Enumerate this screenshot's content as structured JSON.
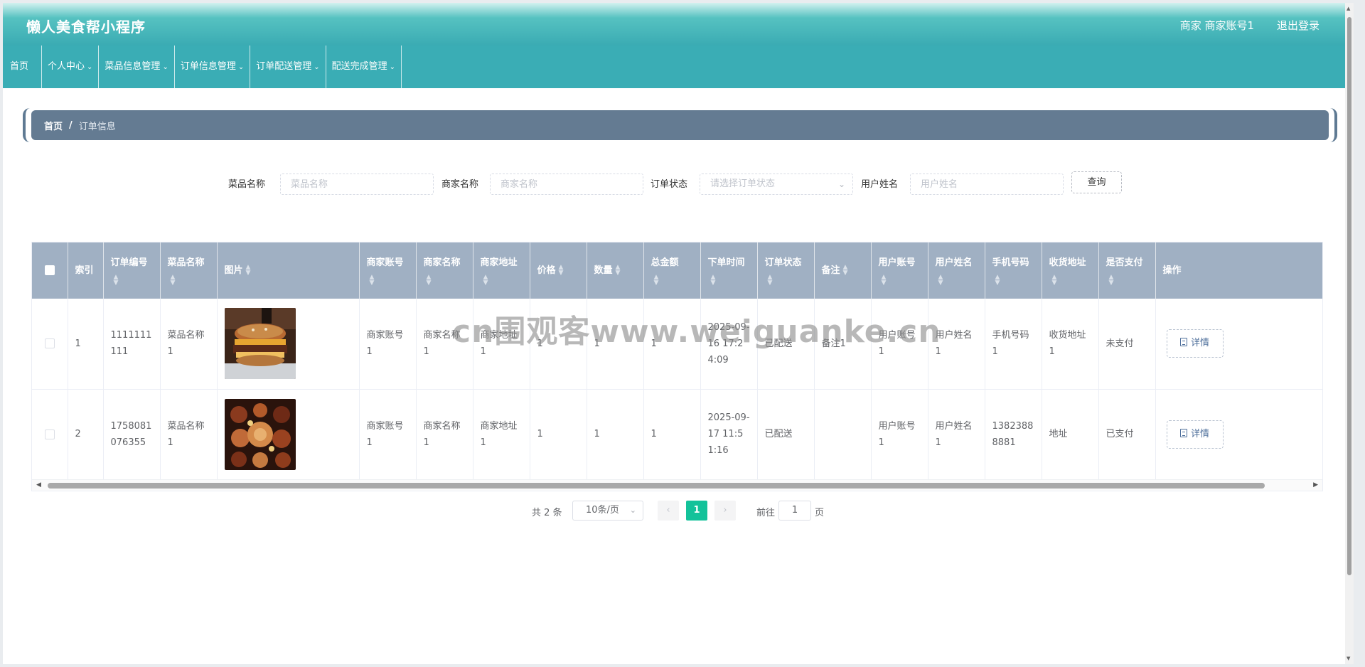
{
  "header": {
    "app_title": "懒人美食帮小程序",
    "user_info": "商家 商家账号1",
    "logout": "退出登录"
  },
  "nav": {
    "items": [
      {
        "label": "首页",
        "has_dropdown": false
      },
      {
        "label": "个人中心",
        "has_dropdown": true
      },
      {
        "label": "菜品信息管理",
        "has_dropdown": true
      },
      {
        "label": "订单信息管理",
        "has_dropdown": true
      },
      {
        "label": "订单配送管理",
        "has_dropdown": true
      },
      {
        "label": "配送完成管理",
        "has_dropdown": true
      }
    ]
  },
  "breadcrumb": {
    "home": "首页",
    "separator": "/",
    "current": "订单信息"
  },
  "search": {
    "dish_label": "菜品名称",
    "dish_placeholder": "菜品名称",
    "merchant_label": "商家名称",
    "merchant_placeholder": "商家名称",
    "status_label": "订单状态",
    "status_placeholder": "请选择订单状态",
    "username_label": "用户姓名",
    "username_placeholder": "用户姓名",
    "query_button": "查询"
  },
  "table": {
    "headers": {
      "index": "索引",
      "order_no": "订单编号",
      "dish_name": "菜品名称",
      "image": "图片",
      "merchant_account": "商家账号",
      "merchant_name": "商家名称",
      "merchant_address": "商家地址",
      "price": "价格",
      "quantity": "数量",
      "total": "总金额",
      "order_time": "下单时间",
      "order_status": "订单状态",
      "remark": "备注",
      "user_account": "用户账号",
      "user_name": "用户姓名",
      "phone": "手机号码",
      "delivery_address": "收货地址",
      "paid": "是否支付",
      "actions": "操作"
    },
    "rows": [
      {
        "index": "1",
        "order_no": "1111111111",
        "dish_name": "菜品名称1",
        "image": "burger",
        "merchant_account": "商家账号1",
        "merchant_name": "商家名称1",
        "merchant_address": "商家地址1",
        "price": "1",
        "quantity": "1",
        "total": "1",
        "order_time": "2025-09-16 17:24:09",
        "order_status": "已配送",
        "remark": "备注1",
        "user_account": "用户账号1",
        "user_name": "用户姓名1",
        "phone": "手机号码1",
        "delivery_address": "收货地址1",
        "paid": "未支付",
        "detail_button": "详情"
      },
      {
        "index": "2",
        "order_no": "1758081076355",
        "dish_name": "菜品名称1",
        "image": "food-spread",
        "merchant_account": "商家账号1",
        "merchant_name": "商家名称1",
        "merchant_address": "商家地址1",
        "price": "1",
        "quantity": "1",
        "total": "1",
        "order_time": "2025-09-17 11:51:16",
        "order_status": "已配送",
        "remark": "",
        "user_account": "用户账号1",
        "user_name": "用户姓名1",
        "phone": "13823888881",
        "delivery_address": "地址",
        "paid": "已支付",
        "detail_button": "详情"
      }
    ]
  },
  "pagination": {
    "total": "共 2 条",
    "page_size": "10条/页",
    "current_page": "1",
    "goto_label": "前往",
    "goto_value": "1",
    "page_suffix": "页"
  },
  "watermark": "cn围观客www.weiguanke.cn",
  "colors": {
    "header_teal": "#3aabb3",
    "nav_teal": "#3aadb5",
    "breadcrumb_slate": "#647b92",
    "table_header": "#a0b0c3",
    "pager_active": "#13c29a"
  }
}
